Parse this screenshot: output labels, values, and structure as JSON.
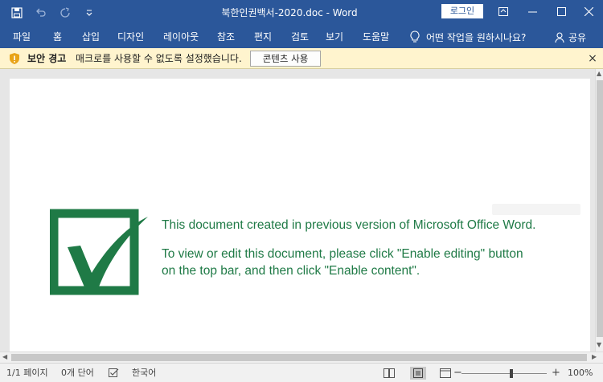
{
  "titlebar": {
    "title": "북한인권백서-2020.doc  -  Word",
    "login_label": "로그인",
    "accent": "#2b579a"
  },
  "ribbon": {
    "tabs": [
      "파일",
      "홈",
      "삽입",
      "디자인",
      "레이아웃",
      "참조",
      "편지",
      "검토",
      "보기",
      "도움말"
    ],
    "tell_me": "어떤 작업을 원하시나요?",
    "share": "공유"
  },
  "message_bar": {
    "title": "보안 경고",
    "text": "매크로를 사용할 수 없도록 설정했습니다.",
    "button": "콘텐츠 사용",
    "close": "×"
  },
  "document": {
    "line1": "This document created in previous version of Microsoft Office Word.",
    "line2": "To view or edit this document, please click \"Enable editing\" button",
    "line3": "on the top bar, and then click \"Enable content\".",
    "text_color": "#1f7a46"
  },
  "status": {
    "page": "1/1 페이지",
    "words": "0개 단어",
    "language": "한국어",
    "zoom_minus": "−",
    "zoom_plus": "+",
    "zoom": "100%"
  },
  "icons": [
    "save-icon",
    "undo-icon",
    "redo-icon",
    "customize-qat-icon",
    "ribbon-display-icon",
    "minimize-icon",
    "maximize-icon",
    "close-icon",
    "lightbulb-icon",
    "person-icon",
    "warning-shield-icon",
    "proofing-icon",
    "read-mode-icon",
    "print-layout-icon",
    "web-layout-icon",
    "checkmark-logo-icon"
  ]
}
